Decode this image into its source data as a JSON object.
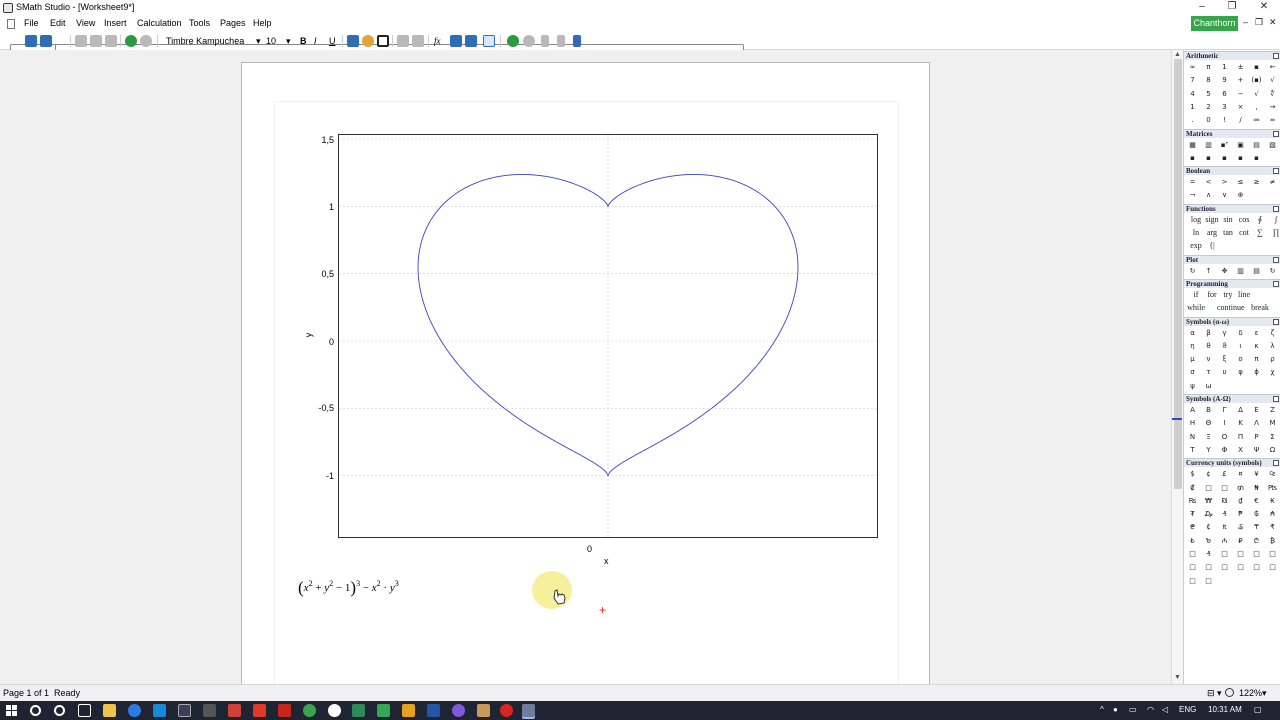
{
  "window": {
    "title": "SMath Studio - [Worksheet9*]",
    "controls": [
      "–",
      "❐",
      "✕"
    ]
  },
  "menu": [
    "File",
    "Edit",
    "View",
    "Insert",
    "Calculation",
    "Tools",
    "Pages",
    "Help"
  ],
  "user_badge": "Chanthorn",
  "mdi_controls": [
    "–",
    "❐",
    "✕"
  ],
  "toolbar": {
    "font_name": "Timbre Kampuchea",
    "font_size": "10",
    "bold": "B",
    "italic": "I",
    "underline": "U",
    "fx": "fx"
  },
  "plot": {
    "y_ticks": [
      "1,5",
      "1",
      "0,5",
      "0",
      "-0,5",
      "-1"
    ],
    "x_tick": "0",
    "xlabel": "x",
    "ylabel": "y",
    "curve_color": "#3c46b4",
    "grid": true
  },
  "formula": {
    "text": "(x^2 + y^2 − 1)^3 − x^2 · y^3",
    "x": "x",
    "y": "y",
    "two": "2",
    "three": "3",
    "one": "1",
    "plus": "+",
    "minus": "−",
    "dot": "·"
  },
  "panel": {
    "sections": [
      {
        "title": "Arithmetic",
        "rows": [
          [
            "∞",
            "π",
            "1",
            "±",
            "▪",
            "←"
          ],
          [
            "7",
            "8",
            "9",
            "+",
            "(▪)",
            "√"
          ],
          [
            "4",
            "5",
            "6",
            "−",
            "√",
            "∜"
          ],
          [
            "1",
            "2",
            "3",
            "×",
            ",",
            "→"
          ],
          [
            ".",
            "0",
            "!",
            "/",
            "≔",
            "═"
          ]
        ]
      },
      {
        "title": "Matrices",
        "rows": [
          [
            "▦",
            "▥",
            "▪ᵀ",
            "▣",
            "▤",
            "▧"
          ],
          [
            "▪",
            "▪",
            "▪",
            "▪",
            "▪"
          ]
        ]
      },
      {
        "title": "Boolean",
        "rows": [
          [
            "=",
            "<",
            ">",
            "≤",
            "≥",
            "≠"
          ],
          [
            "¬",
            "∧",
            "∨",
            "⊕"
          ]
        ]
      },
      {
        "title": "Functions",
        "wide": true,
        "rows": [
          [
            "log",
            "sign",
            "sin",
            "cos",
            "∮",
            "∫"
          ],
          [
            "ln",
            "arg",
            "tan",
            "cot",
            "∑",
            "∏"
          ],
          [
            "exp",
            "{|"
          ]
        ]
      },
      {
        "title": "Plot",
        "rows": [
          [
            "↻",
            "↑",
            "✥",
            "▥",
            "▤",
            "↻"
          ]
        ]
      },
      {
        "title": "Programming",
        "wide": true,
        "rows": [
          [
            "if",
            "for",
            "try",
            "line"
          ],
          [
            "while",
            "continue",
            "break"
          ]
        ]
      },
      {
        "title": "Symbols (α-ω)",
        "rows": [
          [
            "α",
            "β",
            "γ",
            "δ",
            "ε",
            "ζ"
          ],
          [
            "η",
            "θ",
            "ϑ",
            "ι",
            "κ",
            "λ"
          ],
          [
            "μ",
            "ν",
            "ξ",
            "ο",
            "π",
            "ρ"
          ],
          [
            "σ",
            "τ",
            "υ",
            "φ",
            "ϕ",
            "χ"
          ],
          [
            "ψ",
            "ω"
          ]
        ]
      },
      {
        "title": "Symbols (A-Ω)",
        "rows": [
          [
            "Α",
            "Β",
            "Γ",
            "Δ",
            "Ε",
            "Ζ"
          ],
          [
            "Η",
            "Θ",
            "Ι",
            "Κ",
            "Λ",
            "Μ"
          ],
          [
            "Ν",
            "Ξ",
            "Ο",
            "Π",
            "Ρ",
            "Σ"
          ],
          [
            "Τ",
            "Υ",
            "Φ",
            "Χ",
            "Ψ",
            "Ω"
          ]
        ]
      },
      {
        "title": "Currency units (symbols)",
        "rows": [
          [
            "$",
            "¢",
            "£",
            "¤",
            "¥",
            "₠"
          ],
          [
            "₡",
            "□",
            "□",
            "₥",
            "₦",
            "₧"
          ],
          [
            "₨",
            "₩",
            "₪",
            "₫",
            "€",
            "₭"
          ],
          [
            "₮",
            "₯",
            "₰",
            "₱",
            "₲",
            "₳"
          ],
          [
            "₴",
            "₵",
            "₶",
            "₷",
            "₸",
            "₹"
          ],
          [
            "₺",
            "₻",
            "₼",
            "₽",
            "₾",
            "₿"
          ],
          [
            "□",
            "₰",
            "□",
            "□",
            "□",
            "□"
          ],
          [
            "□",
            "□",
            "□",
            "□",
            "□",
            "□"
          ],
          [
            "□",
            "□"
          ]
        ]
      }
    ]
  },
  "status": {
    "page": "Page 1 of 1",
    "state": "Ready",
    "zoom": "122%"
  },
  "taskbar": {
    "lang": "ENG",
    "time": "10:31 AM"
  }
}
